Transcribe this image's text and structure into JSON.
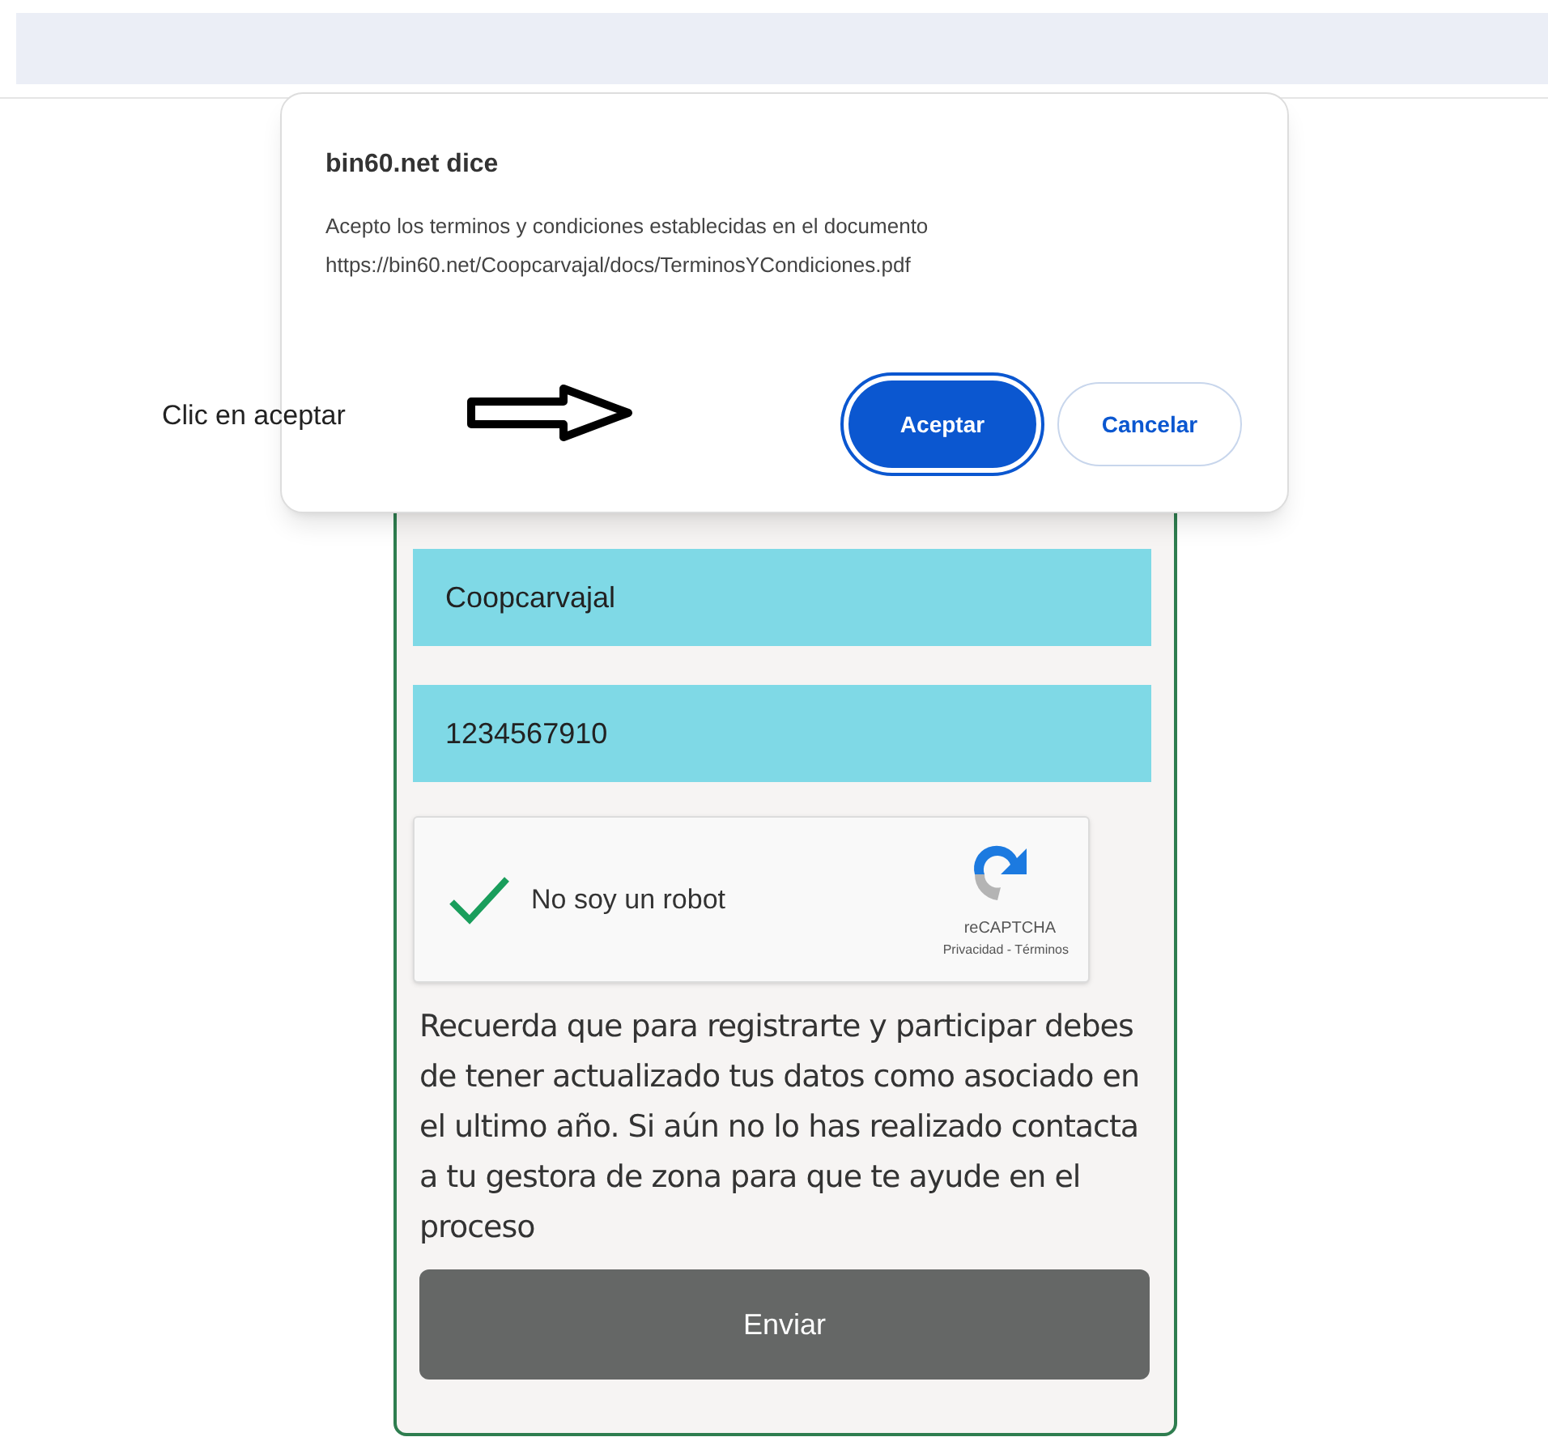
{
  "dialog": {
    "title": "bin60.net dice",
    "message": "Acepto los terminos y condiciones establecidas en el documento",
    "url": "https://bin60.net/Coopcarvajal/docs/TerminosYCondiciones.pdf",
    "buttons": [
      {
        "label": "Aceptar",
        "kind": "primary"
      },
      {
        "label": "Cancelar",
        "kind": "secondary"
      }
    ]
  },
  "annotation": {
    "text": "Clic en aceptar"
  },
  "form": {
    "fields": [
      {
        "value": "Coopcarvajal"
      },
      {
        "value": "1234567910"
      }
    ],
    "captcha": {
      "checked": true,
      "label": "No soy un robot",
      "brand": "reCAPTCHA",
      "links": "Privacidad - Términos"
    },
    "notice": "Recuerda que para registrarte y participar debes de tener actualizado tus datos como asociado en el ultimo año. Si aún no lo has realizado contacta a tu gestora de zona para que te ayude en el proceso",
    "submit": "Enviar"
  }
}
